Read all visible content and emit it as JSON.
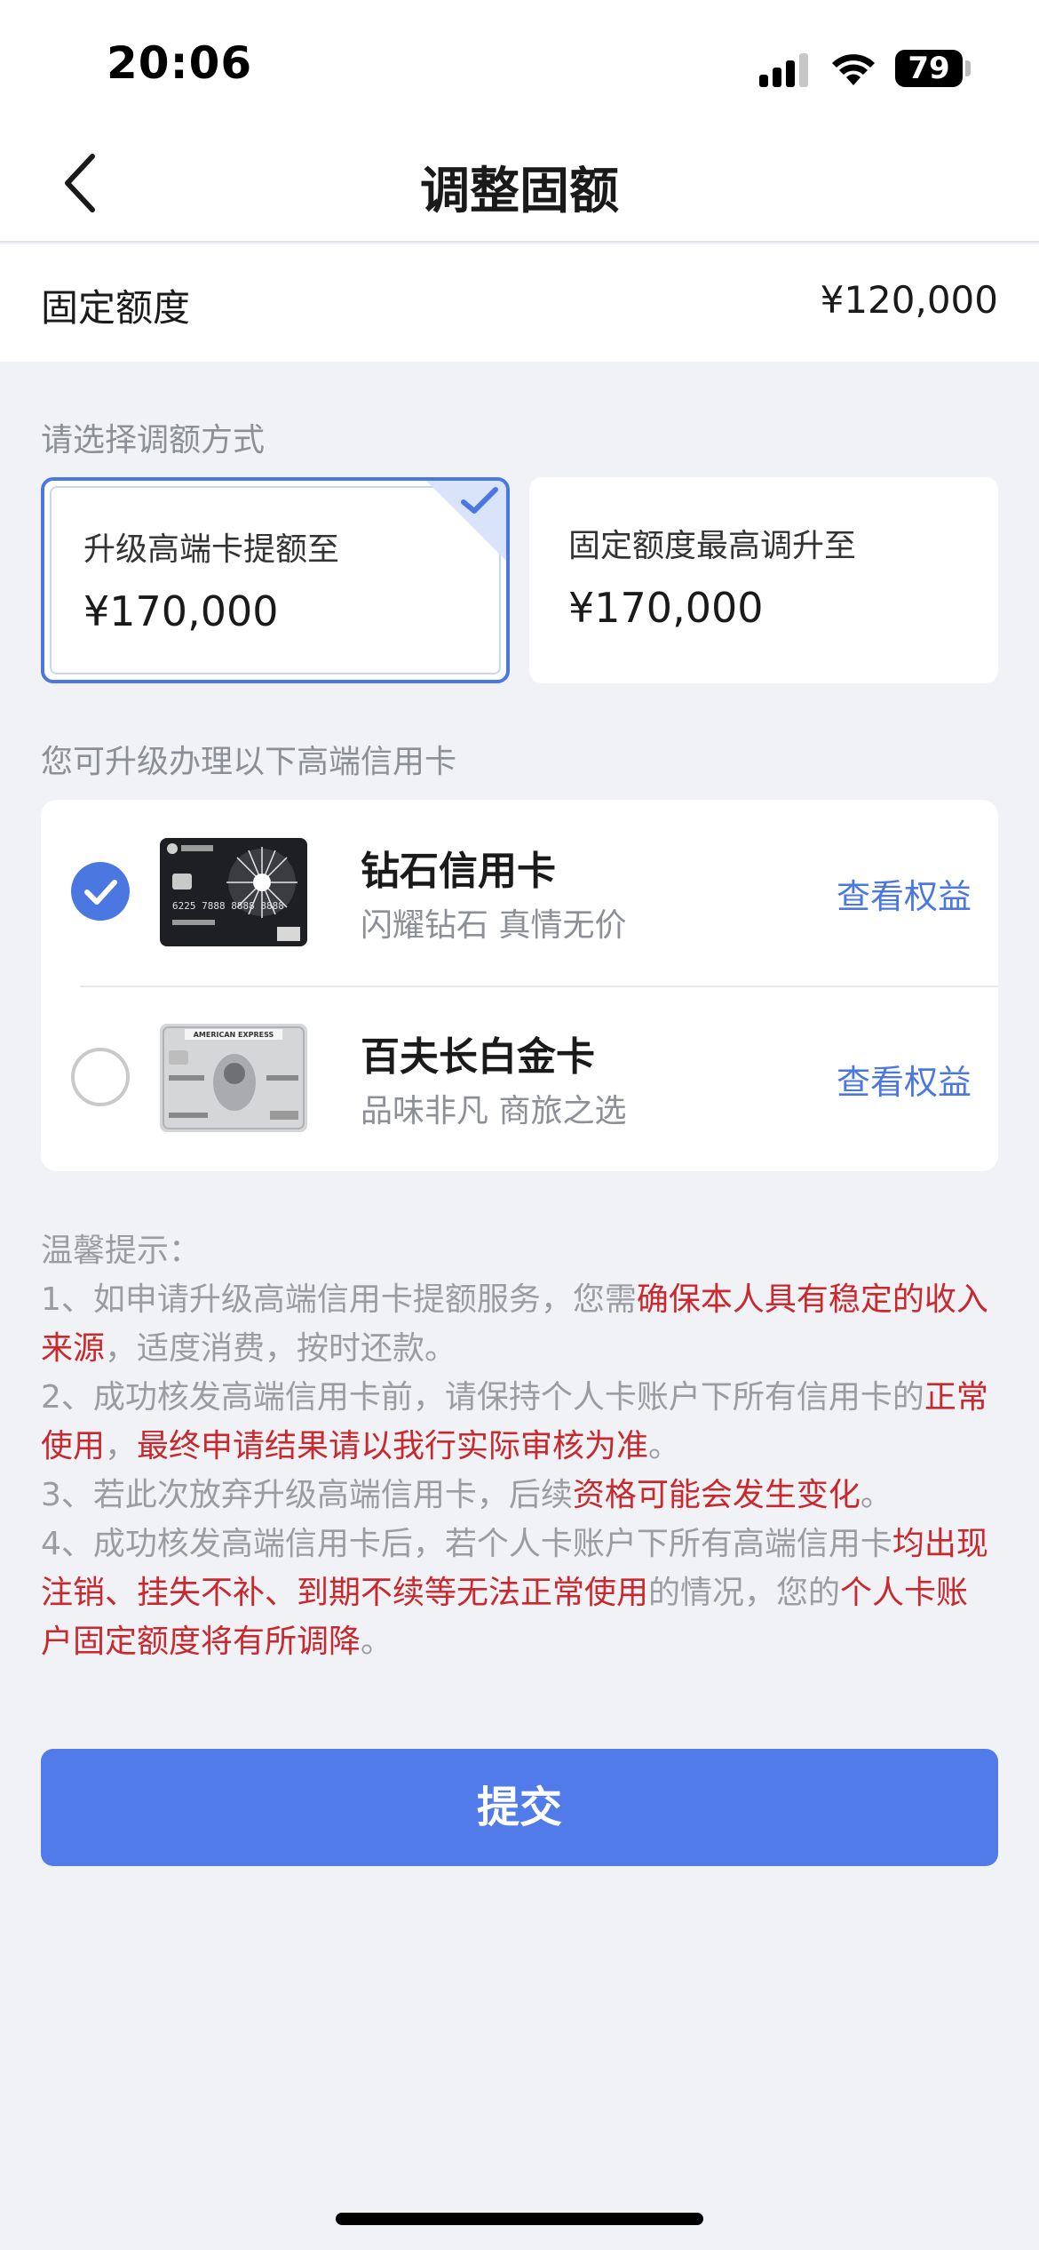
{
  "status_bar": {
    "time": "20:06",
    "battery": "79"
  },
  "nav": {
    "title": "调整固额"
  },
  "quota": {
    "label": "固定额度",
    "value": "¥120,000"
  },
  "method_section": {
    "label": "请选择调额方式"
  },
  "options": [
    {
      "title": "升级高端卡提额至",
      "amount": "¥170,000",
      "selected": true
    },
    {
      "title": "固定额度最高调升至",
      "amount": "¥170,000",
      "selected": false
    }
  ],
  "cards_section": {
    "label": "您可升级办理以下高端信用卡"
  },
  "cards": [
    {
      "name": "钻石信用卡",
      "slogan": "闪耀钻石 真情无价",
      "link": "查看权益",
      "selected": true,
      "thumb_text": "6225 7888 8888 8888"
    },
    {
      "name": "百夫长白金卡",
      "slogan": "品味非凡 商旅之选",
      "link": "查看权益",
      "selected": false,
      "thumb_text": "AMERICAN EXPRESS"
    }
  ],
  "tips": {
    "heading": "温馨提示：",
    "item1_a": "1、如申请升级高端信用卡提额服务，您需",
    "item1_b": "确保本人具有稳定的收入来源",
    "item1_c": "，适度消费，按时还款。",
    "item2_a": "2、成功核发高端信用卡前，请保持个人卡账户下所有信用卡的",
    "item2_b": "正常使用",
    "item2_c": "，",
    "item2_d": "最终申请结果请以我行实际审核为准",
    "item2_e": "。",
    "item3_a": "3、若此次放弃升级高端信用卡，后续",
    "item3_b": "资格可能会发生变化",
    "item3_c": "。",
    "item4_a": "4、成功核发高端信用卡后，若个人卡账户下所有高端信用卡",
    "item4_b": "均出现注销、挂失不补、到期不续等无法正常使用",
    "item4_c": "的情况，您的",
    "item4_d": "个人卡账户固定额度将有所调降",
    "item4_e": "。"
  },
  "submit": {
    "label": "提交"
  },
  "colors": {
    "accent": "#527bea",
    "warning": "#c8282e",
    "muted": "#9a9ca2"
  }
}
